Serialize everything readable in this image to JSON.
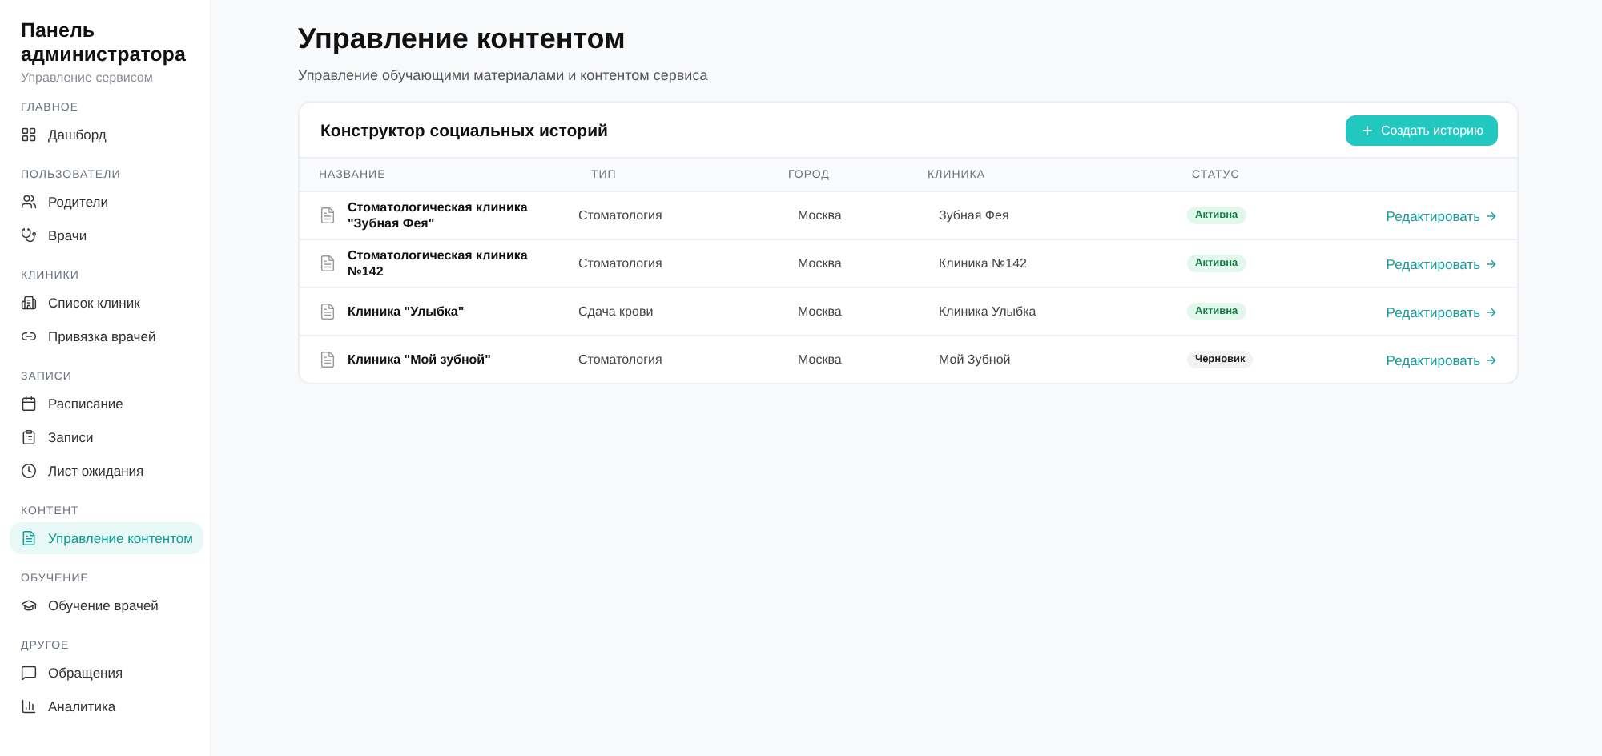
{
  "sidebar": {
    "title": "Панель администратора",
    "subtitle": "Управление сервисом",
    "sections": [
      {
        "title": "ГЛАВНОЕ",
        "items": [
          {
            "label": "Дашборд",
            "selected": false
          }
        ]
      },
      {
        "title": "ПОЛЬЗОВАТЕЛИ",
        "items": [
          {
            "label": "Родители",
            "selected": false
          },
          {
            "label": "Врачи",
            "selected": false
          }
        ]
      },
      {
        "title": "КЛИНИКИ",
        "items": [
          {
            "label": "Список клиник",
            "selected": false
          },
          {
            "label": "Привязка врачей",
            "selected": false
          }
        ]
      },
      {
        "title": "ЗАПИСИ",
        "items": [
          {
            "label": "Расписание",
            "selected": false
          },
          {
            "label": "Записи",
            "selected": false
          },
          {
            "label": "Лист ожидания",
            "selected": false
          }
        ]
      },
      {
        "title": "КОНТЕНТ",
        "items": [
          {
            "label": "Управление контентом",
            "selected": true
          }
        ]
      },
      {
        "title": "ОБУЧЕНИЕ",
        "items": [
          {
            "label": "Обучение врачей",
            "selected": false
          }
        ]
      },
      {
        "title": "ДРУГОЕ",
        "items": [
          {
            "label": "Обращения",
            "selected": false
          },
          {
            "label": "Аналитика",
            "selected": false
          }
        ]
      }
    ]
  },
  "page": {
    "title": "Управление контентом",
    "subtitle": "Управление обучающими материалами и контентом сервиса"
  },
  "card": {
    "title": "Конструктор социальных историй",
    "button": "Создать историю",
    "columns": [
      "НАЗВАНИЕ",
      "ТИП",
      "ГОРОД",
      "КЛИНИКА",
      "СТАТУС"
    ],
    "rows": [
      {
        "name": "Стоматологическая клиника \"Зубная Фея\"",
        "type": "Стоматология",
        "city": "Москва",
        "clinic": "Зубная Фея",
        "status": {
          "label": "Активна",
          "kind": "active"
        },
        "action": "Редактировать"
      },
      {
        "name": "Стоматологическая клиника №142",
        "type": "Стоматология",
        "city": "Москва",
        "clinic": "Клиника №142",
        "status": {
          "label": "Активна",
          "kind": "active"
        },
        "action": "Редактировать"
      },
      {
        "name": "Клиника \"Улыбка\"",
        "type": "Сдача крови",
        "city": "Москва",
        "clinic": "Клиника Улыбка",
        "status": {
          "label": "Активна",
          "kind": "active"
        },
        "action": "Редактировать"
      },
      {
        "name": "Клиника \"Мой зубной\"",
        "type": "Стоматология",
        "city": "Москва",
        "clinic": "Мой Зубной",
        "status": {
          "label": "Черновик",
          "kind": "draft"
        },
        "action": "Редактировать"
      }
    ]
  }
}
